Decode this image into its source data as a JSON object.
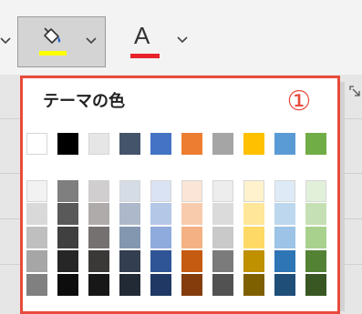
{
  "ribbon": {
    "font_color_letter": "A",
    "fill_color": "#FFFF00",
    "font_color": "#E8232A"
  },
  "panel": {
    "title": "テーマの色",
    "annotation": "①",
    "accent": "#E84B3C"
  },
  "theme_colors": {
    "base": [
      "#FFFFFF",
      "#000000",
      "#E7E6E6",
      "#44546A",
      "#4472C4",
      "#ED7D31",
      "#A5A5A5",
      "#FFC000",
      "#5B9BD5",
      "#70AD47"
    ],
    "shades": [
      [
        "#F2F2F2",
        "#7F7F7F",
        "#D0CECE",
        "#D6DCE5",
        "#DAE3F3",
        "#FBE5D6",
        "#EDEDED",
        "#FFF2CC",
        "#DEEBF7",
        "#E2F0D9"
      ],
      [
        "#D9D9D9",
        "#595959",
        "#AFABAB",
        "#ADB9CA",
        "#B4C7E7",
        "#F8CBAD",
        "#DBDBDB",
        "#FFE699",
        "#BDD7EE",
        "#C5E0B4"
      ],
      [
        "#BFBFBF",
        "#404040",
        "#767171",
        "#8497B0",
        "#8FAADC",
        "#F4B183",
        "#C9C9C9",
        "#FFD966",
        "#9DC3E6",
        "#A9D18E"
      ],
      [
        "#A6A6A6",
        "#262626",
        "#3B3838",
        "#333F50",
        "#2F5597",
        "#C55A11",
        "#7B7B7B",
        "#BF9000",
        "#2E75B6",
        "#548235"
      ],
      [
        "#808080",
        "#0D0D0D",
        "#171717",
        "#222A35",
        "#203864",
        "#843C0C",
        "#525252",
        "#7F6000",
        "#1F4E79",
        "#385723"
      ]
    ]
  }
}
